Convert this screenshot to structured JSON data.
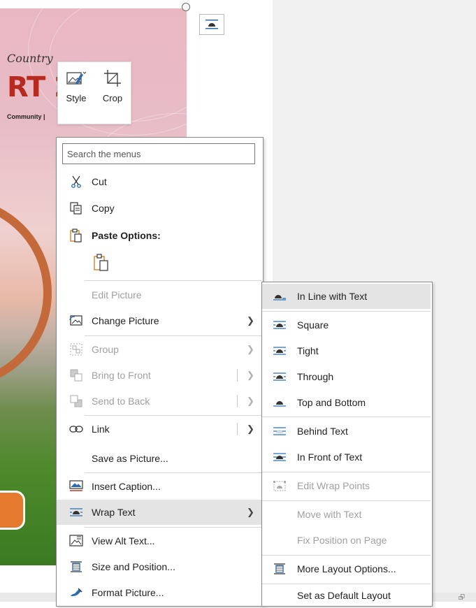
{
  "mini_toolbar": {
    "style_label": "Style",
    "crop_label": "Crop"
  },
  "poster": {
    "script_text": "Country",
    "big_letters": "RT 2",
    "community_text": "Community |"
  },
  "search": {
    "placeholder": "Search the menus"
  },
  "menu": {
    "cut": "Cut",
    "copy": "Copy",
    "paste_options": "Paste Options:",
    "edit_picture": "Edit Picture",
    "change_picture": "Change Picture",
    "group": "Group",
    "bring_to_front": "Bring to Front",
    "send_to_back": "Send to Back",
    "link": "Link",
    "save_as_picture": "Save as Picture...",
    "insert_caption": "Insert Caption...",
    "wrap_text": "Wrap Text",
    "view_alt_text": "View Alt Text...",
    "size_and_position": "Size and Position...",
    "format_picture": "Format Picture..."
  },
  "submenu": {
    "in_line_with_text": "In Line with Text",
    "square": "Square",
    "tight": "Tight",
    "through": "Through",
    "top_and_bottom": "Top and Bottom",
    "behind_text": "Behind Text",
    "in_front_of_text": "In Front of Text",
    "edit_wrap_points": "Edit Wrap Points",
    "move_with_text": "Move with Text",
    "fix_position_on_page": "Fix Position on Page",
    "more_layout_options": "More Layout Options...",
    "set_as_default_layout": "Set as Default Layout"
  },
  "colors": {
    "accent_blue": "#2b6cb0",
    "disabled_text": "#a0a0a0",
    "highlight": "#e4e4e4"
  }
}
